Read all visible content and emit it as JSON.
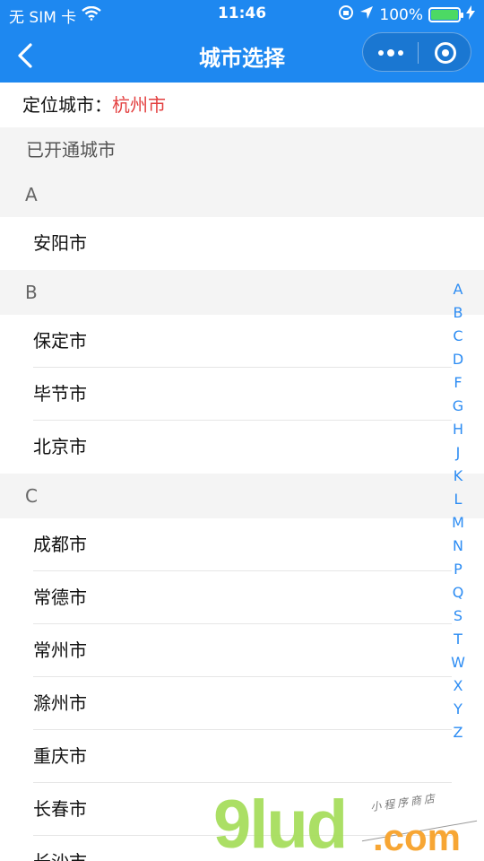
{
  "status_bar": {
    "carrier": "无 SIM 卡",
    "time": "11:46",
    "battery": "100%",
    "battery_level": 1.0
  },
  "nav": {
    "title": "城市选择"
  },
  "location": {
    "label": "定位城市：",
    "city": "杭州市"
  },
  "list": {
    "opened_header": "已开通城市",
    "sections": [
      {
        "letter": "A",
        "cities": [
          "安阳市"
        ]
      },
      {
        "letter": "B",
        "cities": [
          "保定市",
          "毕节市",
          "北京市"
        ]
      },
      {
        "letter": "C",
        "cities": [
          "成都市",
          "常德市",
          "常州市",
          "滁州市",
          "重庆市",
          "长春市",
          "长沙市"
        ]
      }
    ]
  },
  "index_letters": [
    "A",
    "B",
    "C",
    "D",
    "F",
    "G",
    "H",
    "J",
    "K",
    "L",
    "M",
    "N",
    "P",
    "Q",
    "S",
    "T",
    "W",
    "X",
    "Y",
    "Z"
  ],
  "watermark": {
    "brand": "9lud",
    "tld": ".com",
    "tagline": "小程序商店"
  },
  "colors": {
    "nav_bg": "#1e88f0",
    "location_city": "#e33f3f",
    "index": "#2c8cf3",
    "section_bg": "#f4f4f4"
  }
}
